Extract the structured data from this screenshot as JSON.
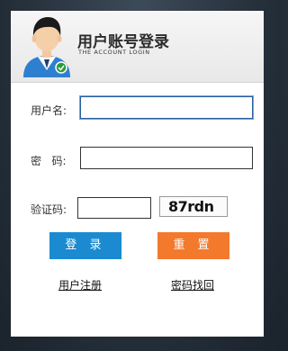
{
  "header": {
    "title": "用户账号登录",
    "subtitle": "THE ACCOUNT LOGIN"
  },
  "form": {
    "username_label": "用户名:",
    "username_value": "",
    "password_label": "密   码:",
    "password_value": "",
    "captcha_label": "验证码:",
    "captcha_value": "",
    "captcha_image_text": "87rdn"
  },
  "buttons": {
    "login": "登 录",
    "reset": "重 置"
  },
  "links": {
    "register": "用户注册",
    "recover_password": "密码找回"
  },
  "colors": {
    "login_button": "#1b8ad1",
    "reset_button": "#f3792d",
    "background": "#27323d"
  },
  "icons": {
    "avatar": "user-avatar-icon"
  }
}
